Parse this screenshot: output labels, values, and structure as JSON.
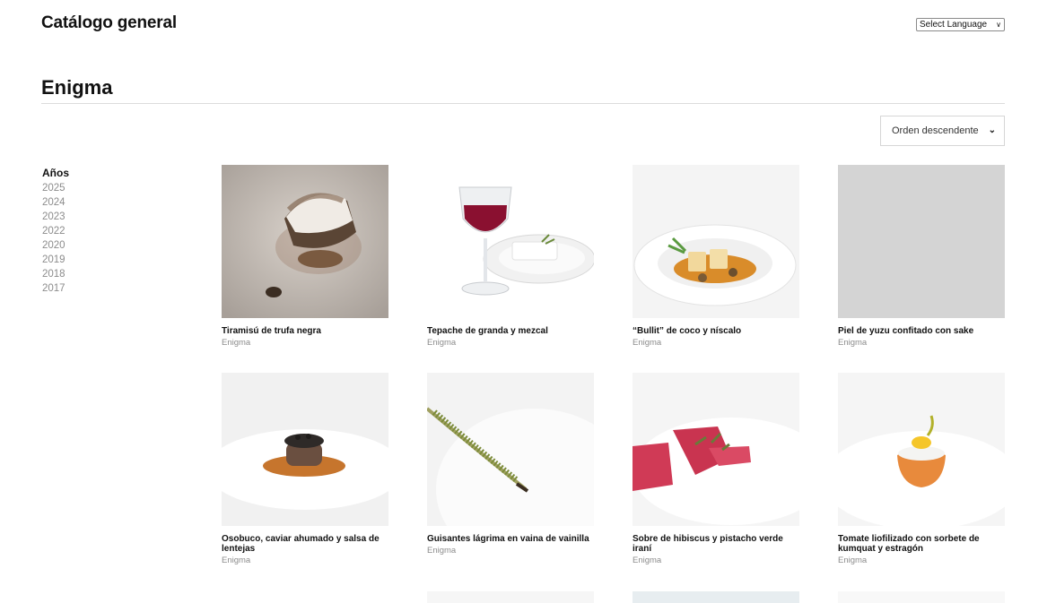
{
  "header": {
    "site_title": "Catálogo general",
    "language_select": "Select Language"
  },
  "page": {
    "title": "Enigma",
    "sort_label": "Orden descendente"
  },
  "filters": {
    "years_heading": "Años",
    "years": [
      "2025",
      "2024",
      "2023",
      "2022",
      "2020",
      "2019",
      "2018",
      "2017"
    ]
  },
  "dishes": [
    {
      "name": "Tiramisú de trufa negra",
      "restaurant": "Enigma"
    },
    {
      "name": "Tepache de granda y mezcal",
      "restaurant": "Enigma"
    },
    {
      "name": "“Bullit” de coco y níscalo",
      "restaurant": "Enigma"
    },
    {
      "name": "Piel de yuzu confitado con sake",
      "restaurant": "Enigma"
    },
    {
      "name": "Osobuco, caviar ahumado y salsa de lentejas",
      "restaurant": "Enigma"
    },
    {
      "name": "Guisantes lágrima en vaina de vainilla",
      "restaurant": "Enigma"
    },
    {
      "name": "Sobre de hibiscus y pistacho verde iraní",
      "restaurant": "Enigma"
    },
    {
      "name": "Tomate liofilizado con sorbete de kumquat y estragón",
      "restaurant": "Enigma"
    }
  ],
  "colors": {
    "year_link": "#8c8c8c",
    "divider": "#dcdcdc",
    "placeholder": "#d4d4d4"
  }
}
